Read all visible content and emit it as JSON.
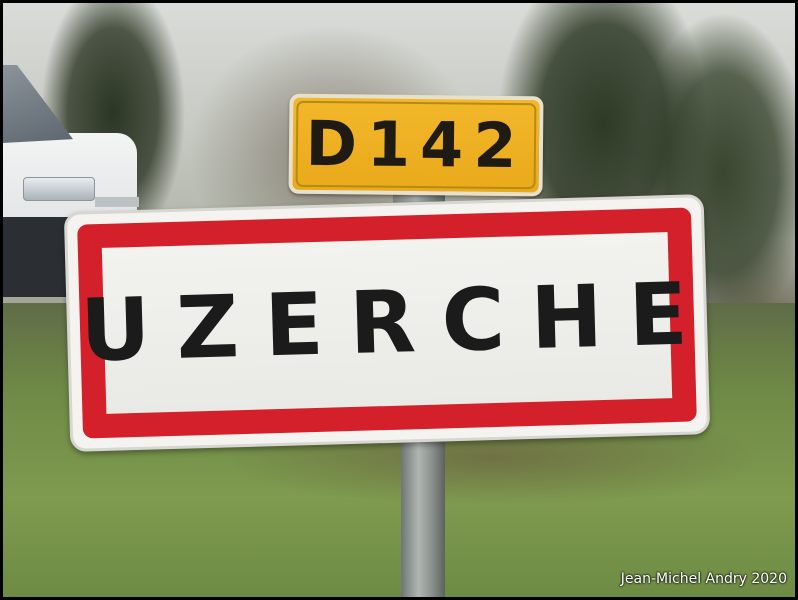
{
  "photo": {
    "subject": "town-entry-sign",
    "route_sign": {
      "label": "D142",
      "background": "#f2b72a",
      "text_color": "#1f1b14"
    },
    "town_sign": {
      "name": "UZERCHE",
      "border_color": "#d3202a",
      "background": "#f2f2ee",
      "text_color": "#1b1b1b"
    },
    "credit": "Jean-Michel Andry 2020"
  }
}
